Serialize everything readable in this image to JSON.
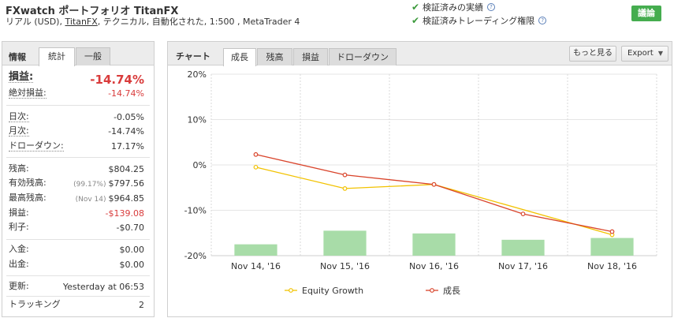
{
  "header": {
    "title": "FXwatch ポートフォリオ TitanFX",
    "subtitle_prefix": "リアル (USD), ",
    "subtitle_link": "TitanFX",
    "subtitle_suffix": ", テクニカル, 自動化された, 1:500 , MetaTrader 4",
    "verified_track": "検証済みの実績",
    "verified_trading": "検証済みトレーディング権限",
    "help_glyph": "?",
    "discuss_button": "議論"
  },
  "left_panel": {
    "heading": "情報",
    "tabs": [
      {
        "label": "統計",
        "active": true
      },
      {
        "label": "一般",
        "active": false
      }
    ],
    "stats": {
      "gain_label": "損益:",
      "gain_value": "-14.74%",
      "abs_gain_label": "絶対損益:",
      "abs_gain_value": "-14.74%",
      "daily_label": "日次:",
      "daily_value": "-0.05%",
      "monthly_label": "月次:",
      "monthly_value": "-14.74%",
      "drawdown_label": "ドローダウン:",
      "drawdown_value": "17.17%",
      "balance_label": "残高:",
      "balance_value": "$804.25",
      "equity_label": "有効残高:",
      "equity_note": "(99.17%)",
      "equity_value": "$797.56",
      "highest_label": "最高残高:",
      "highest_note": "(Nov 14)",
      "highest_value": "$964.85",
      "profit_label": "損益:",
      "profit_value": "-$139.08",
      "interest_label": "利子:",
      "interest_value": "-$0.70",
      "deposits_label": "入金:",
      "deposits_value": "$0.00",
      "withdrawals_label": "出金:",
      "withdrawals_value": "$0.00",
      "updated_label": "更新:",
      "updated_value": "Yesterday at 06:53",
      "tracking_label": "トラッキング",
      "tracking_value": "2"
    }
  },
  "right_panel": {
    "heading": "チャート",
    "tabs": [
      {
        "label": "成長",
        "active": true
      },
      {
        "label": "残高",
        "active": false
      },
      {
        "label": "損益",
        "active": false
      },
      {
        "label": "ドローダウン",
        "active": false
      }
    ],
    "more_button": "もっと見る",
    "export_button": "Export",
    "export_caret": "▼"
  },
  "chart_data": {
    "type": "line",
    "categories": [
      "Nov 14, '16",
      "Nov 15, '16",
      "Nov 16, '16",
      "Nov 17, '16",
      "Nov 18, '16"
    ],
    "ylim": [
      -20,
      20
    ],
    "yticks": [
      "20%",
      "10%",
      "0%",
      "-10%",
      "-20%"
    ],
    "ytick_values": [
      20,
      10,
      0,
      -10,
      -20
    ],
    "grid": "vertical dashed + horizontal",
    "legend_position": "bottom",
    "series": [
      {
        "name": "Equity Growth",
        "kind": "line",
        "color": "#f2c200",
        "values": [
          -0.5,
          -5.2,
          -4.3,
          null,
          -15.4
        ]
      },
      {
        "name": "成長",
        "kind": "line",
        "color": "#d9442b",
        "values": [
          2.3,
          -2.2,
          -4.3,
          -10.8,
          -14.7
        ]
      },
      {
        "kind": "bar",
        "color": "#a8dca8",
        "values": [
          -17.5,
          -14.5,
          -15.1,
          -16.5,
          -16.1
        ]
      }
    ]
  }
}
